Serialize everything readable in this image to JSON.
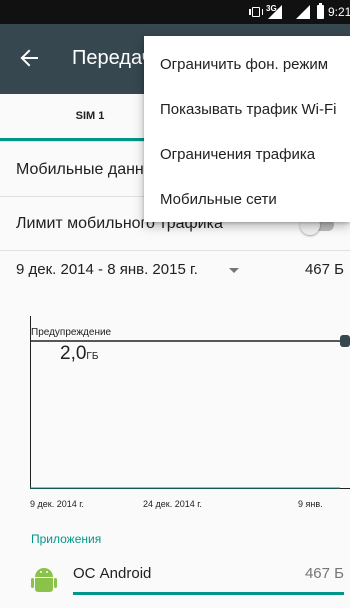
{
  "status_bar": {
    "network": "3G",
    "time": "9:21"
  },
  "toolbar": {
    "title": "Передача данных"
  },
  "tabs": [
    {
      "label": "SIM 1",
      "selected": true
    }
  ],
  "settings": {
    "mobile_data_label": "Мобильные данные",
    "mobile_limit_label": "Лимит мобильного трафика",
    "mobile_limit_on": false
  },
  "cycle": {
    "range": "9 дек. 2014 - 8 янв. 2015 г.",
    "total": "467 Б"
  },
  "chart": {
    "warning_label": "Предупреждение",
    "warning_value": "2,0",
    "warning_unit": "ГБ",
    "x_labels": [
      "9 дек. 2014 г.",
      "24 дек. 2014 г.",
      "9 янв."
    ]
  },
  "chart_data": {
    "type": "line",
    "x": [
      "9 дек. 2014 г.",
      "24 дек. 2014 г.",
      "9 янв."
    ],
    "series": [
      {
        "values": [
          0,
          0,
          0
        ]
      }
    ],
    "title": "",
    "xlabel": "",
    "ylabel": "",
    "annotations": [
      "Предупреждение 2,0 ГБ"
    ],
    "grid": false,
    "legend": "none"
  },
  "apps": {
    "header": "Приложения",
    "items": [
      {
        "name": "ОС Android",
        "usage": "467 Б",
        "share": 1.0
      }
    ]
  },
  "menu": {
    "items": [
      "Ограничить фон. режим",
      "Показывать трафик Wi-Fi",
      "Ограничения трафика",
      "Мобильные сети"
    ]
  },
  "colors": {
    "toolbar": "#37474f",
    "accent": "#009688",
    "status_bar": "#111111",
    "android": "#8bc34a"
  }
}
